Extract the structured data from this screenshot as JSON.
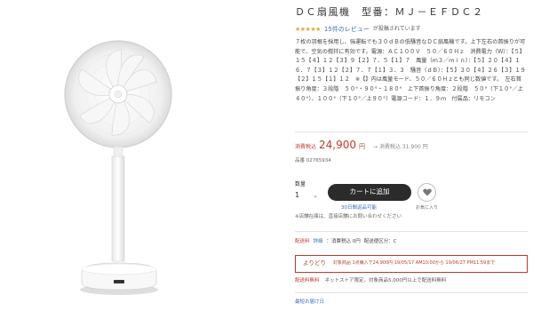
{
  "product": {
    "title": "ＤＣ扇風機　型番：ＭＪ－ＥＦＤＣ２",
    "stars": "★★★★★",
    "rating_value": 4.5,
    "review_link": "15件のレビュー",
    "review_suffix": "が投稿されています",
    "description": "７枚の羽根を採用し、強運転でも３０ｄＢの低騒音なＤＣ扇風機です。上下左右の首振りが可能で、空気の撹拌に有効です。電源：ＡＣ１００Ｖ　５０／６０Ｈｚ　消費電力（Ｗ）：【５】１５【４】１２【３】９【２】７．５【１】７　風量（ｍ３／ｍｉｎ）：【５】２０【４】１６．７【３】１２【２】７．７【１】３．３　騒音（ｄＢ）：【５】３０【４】２６【３】１９【２】１５【１】１２　※【】内は風量モード、５０／６０Ｈｚとも同じ数値です。　左右首振り角度：３段階　５０°・９０°・１８０°　上下首振り角度：２段階　５０°（下１０°／上４０°）、１００°（下１０°／上９０°）電源コード：１．９ｍ　付属品：リモコン"
  },
  "price": {
    "label": "消費税込",
    "value": "24,900",
    "yen": "円",
    "regular": "→ 消費税込 31,900 円"
  },
  "code": "品番 02765934",
  "quantity": {
    "label": "数量",
    "value": "1",
    "chevron": "⌄"
  },
  "cart_button": "カートに追加",
  "days_link": "30日間返品可能",
  "favorite_label": "お気に入り",
  "notice": "※店舗在庫は、直接店舗にお問い合わせください",
  "delivery": {
    "label": "配送料",
    "link": "詳細",
    "fee": "：消費税込 0円",
    "category": "配送便区分：C"
  },
  "sale": {
    "badge": "よりどり",
    "text": "対象商品 1点購入で24,900円 19/05/17 AM10:00から 19/06/27 PM11:59まで"
  },
  "free_shipping": {
    "label": "配送料無料",
    "text": "ネットストア限定。対象商品5,000円以上で配送料無料"
  },
  "bottom_link": "最短お届け日",
  "colors": {
    "accent": "#c0392b",
    "link": "#3b6fb6",
    "button": "#2b2b2b",
    "star": "#e6a23c"
  }
}
